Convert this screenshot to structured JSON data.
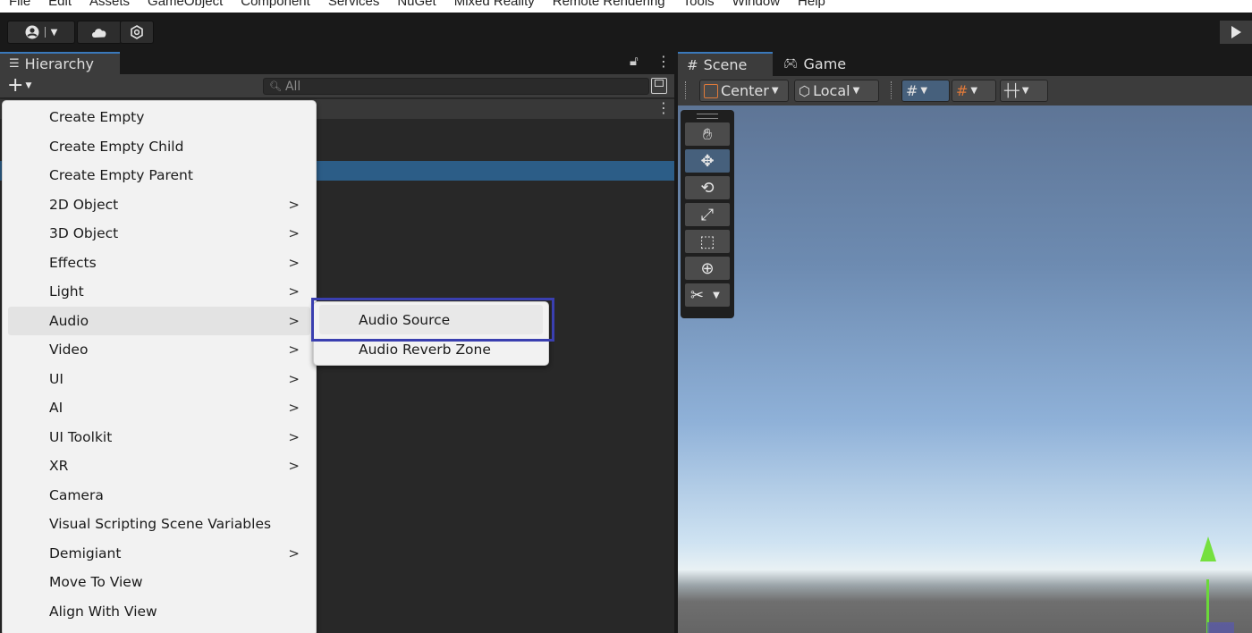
{
  "menubar": {
    "items": [
      "File",
      "Edit",
      "Assets",
      "GameObject",
      "Component",
      "Services",
      "NuGet",
      "Mixed Reality",
      "Remote Rendering",
      "Tools",
      "Window",
      "Help"
    ]
  },
  "hierarchy": {
    "tab_label": "Hierarchy",
    "add_label": "+",
    "search_placeholder": "All"
  },
  "scene": {
    "tabs": [
      {
        "label": "Scene",
        "icon": "grid-icon"
      },
      {
        "label": "Game",
        "icon": "gamepad-icon"
      }
    ],
    "pivot_label": "Center",
    "space_label": "Local"
  },
  "context_menu": {
    "items": [
      {
        "label": "Create Empty",
        "submenu": false
      },
      {
        "label": "Create Empty Child",
        "submenu": false
      },
      {
        "label": "Create Empty Parent",
        "submenu": false
      },
      {
        "label": "2D Object",
        "submenu": true
      },
      {
        "label": "3D Object",
        "submenu": true
      },
      {
        "label": "Effects",
        "submenu": true
      },
      {
        "label": "Light",
        "submenu": true
      },
      {
        "label": "Audio",
        "submenu": true
      },
      {
        "label": "Video",
        "submenu": true
      },
      {
        "label": "UI",
        "submenu": true
      },
      {
        "label": "AI",
        "submenu": true
      },
      {
        "label": "UI Toolkit",
        "submenu": true
      },
      {
        "label": "XR",
        "submenu": true
      },
      {
        "label": "Camera",
        "submenu": false
      },
      {
        "label": "Visual Scripting Scene Variables",
        "submenu": false
      },
      {
        "label": "Demigiant",
        "submenu": true
      },
      {
        "label": "Move To View",
        "submenu": false
      },
      {
        "label": "Align With View",
        "submenu": false
      }
    ],
    "arrow_glyph": ">"
  },
  "audio_submenu": {
    "items": [
      "Audio Source",
      "Audio Reverb Zone"
    ]
  },
  "colors": {
    "selection": "#2c5d87",
    "highlight_box": "#3a3fb0",
    "gizmo_y": "#6bd93a"
  }
}
